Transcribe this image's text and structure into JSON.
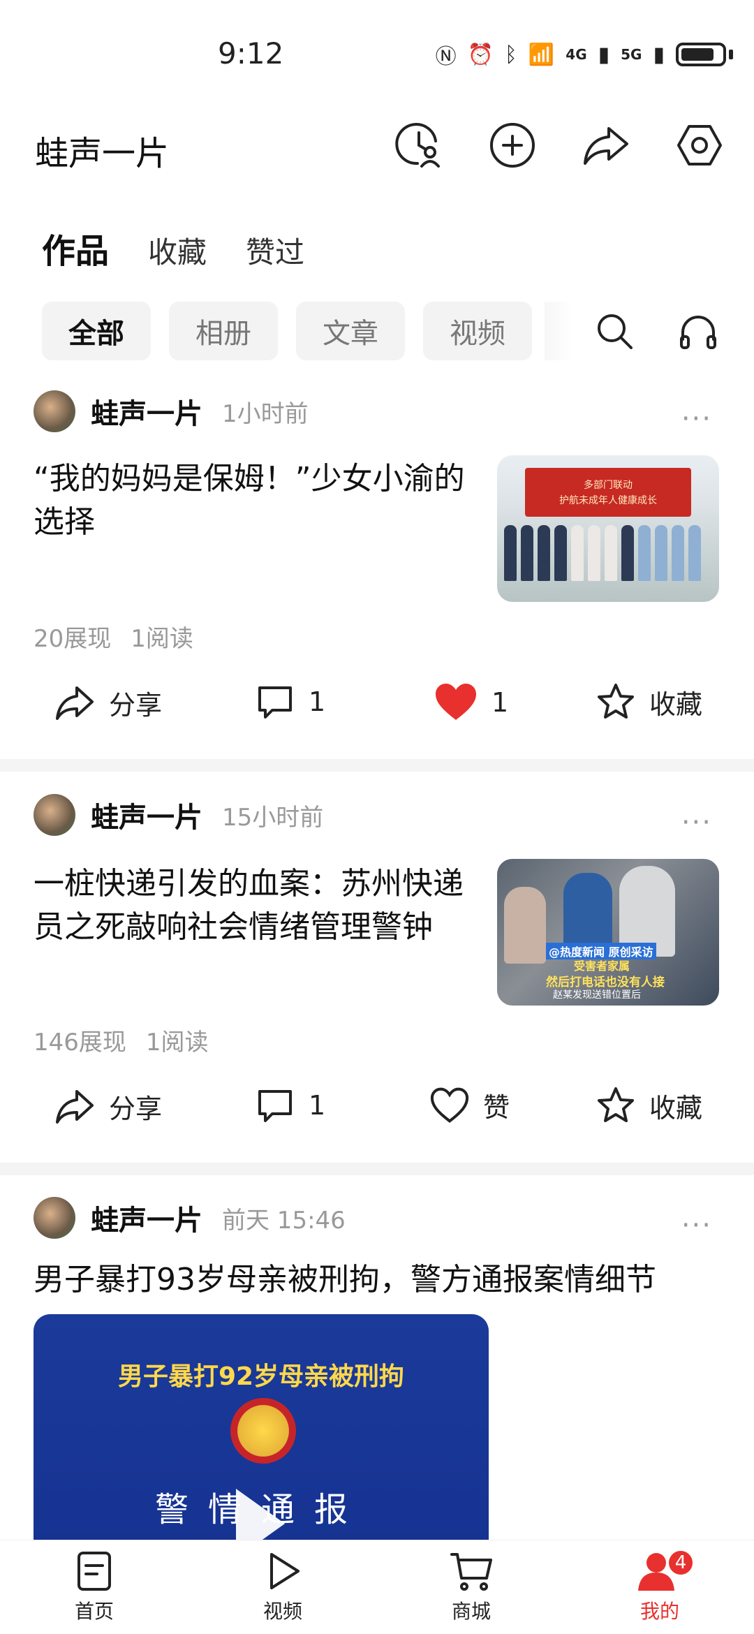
{
  "status_bar": {
    "time": "9:12",
    "network_1": "4G",
    "network_2": "5G"
  },
  "header": {
    "title": "蛙声一片",
    "icons": [
      "visitor-icon",
      "add-icon",
      "share-icon",
      "settings-icon"
    ]
  },
  "tabs": [
    {
      "label": "作品",
      "active": true
    },
    {
      "label": "收藏",
      "active": false
    },
    {
      "label": "赞过",
      "active": false
    }
  ],
  "filters": [
    {
      "label": "全部",
      "active": true
    },
    {
      "label": "相册",
      "active": false
    },
    {
      "label": "文章",
      "active": false
    },
    {
      "label": "视频",
      "active": false
    }
  ],
  "posts": [
    {
      "author": "蛙声一片",
      "time": "1小时前",
      "title": "“我的妈妈是保姆！”少女小渝的选择",
      "thumbnail_text": [
        "多部门联动",
        "护航未成年人健康成长"
      ],
      "views": "20展现",
      "reads": "1阅读",
      "share_label": "分享",
      "comment_count": "1",
      "like_label": "1",
      "liked": true,
      "collect_label": "收藏"
    },
    {
      "author": "蛙声一片",
      "time": "15小时前",
      "title": "一桩快递引发的血案：苏州快递员之死敲响社会情绪管理警钟",
      "thumbnail_text": [
        "@热度新闻 原创采访",
        "受害者家属",
        "然后打电话也没有人接",
        "赵某发现送错位置后"
      ],
      "views": "146展现",
      "reads": "1阅读",
      "share_label": "分享",
      "comment_count": "1",
      "like_label": "赞",
      "liked": false,
      "collect_label": "收藏"
    },
    {
      "author": "蛙声一片",
      "time": "前天  15:46",
      "title": "男子暴打93岁母亲被刑拘，警方通报案情细节",
      "thumbnail_text": [
        "男子暴打92岁母亲被刑拘",
        "警情通报"
      ]
    }
  ],
  "bottom_nav": [
    {
      "label": "首页",
      "icon": "home-doc-icon",
      "active": false
    },
    {
      "label": "视频",
      "icon": "play-icon",
      "active": false
    },
    {
      "label": "商城",
      "icon": "cart-icon",
      "active": false
    },
    {
      "label": "我的",
      "icon": "profile-icon",
      "active": true,
      "badge": "4"
    }
  ],
  "colors": {
    "accent_red": "#e8302e",
    "chip_bg": "#f3f3f3",
    "muted_text": "#999999"
  }
}
